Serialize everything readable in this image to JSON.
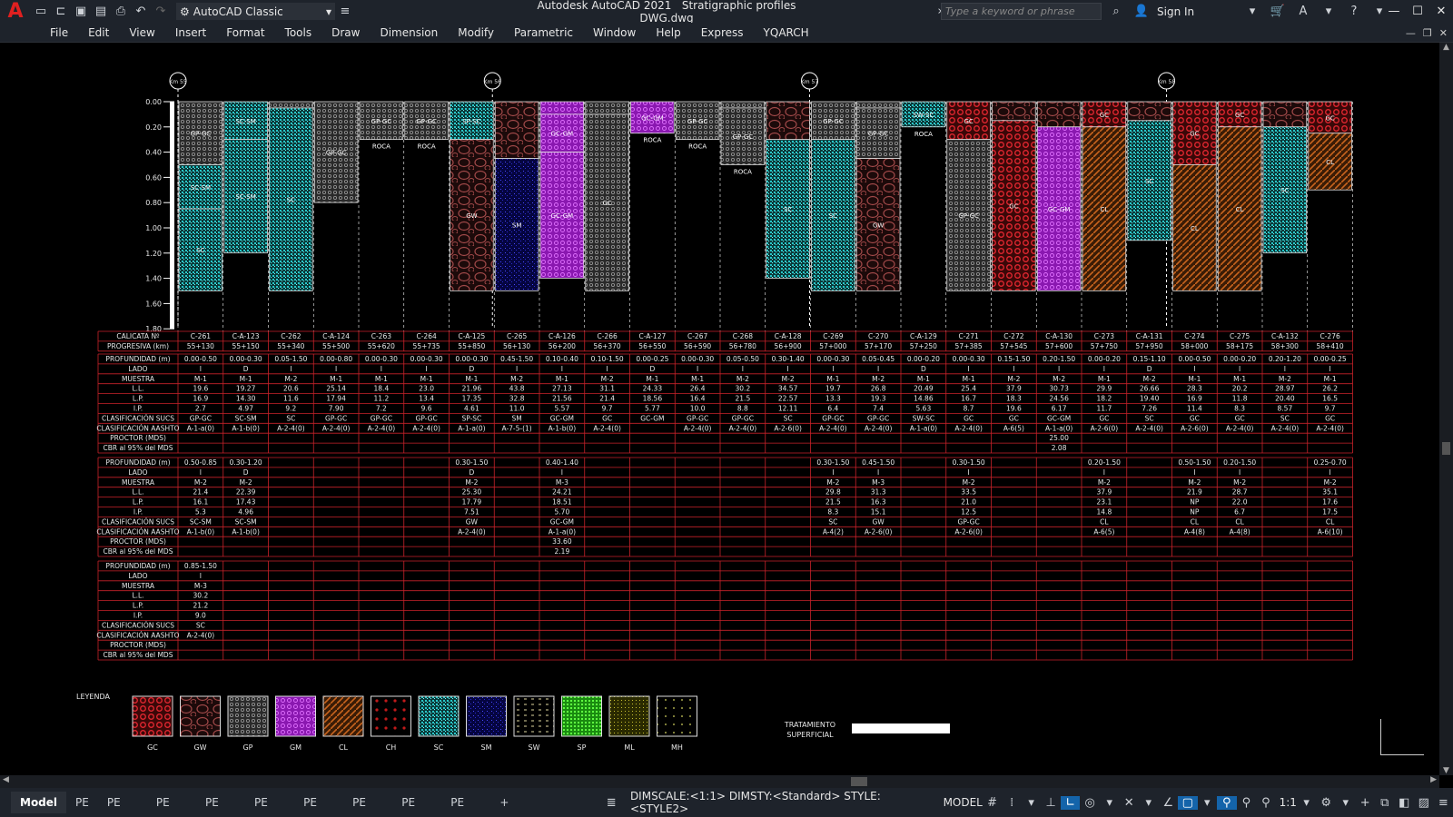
{
  "app": {
    "title": "Autodesk AutoCAD 2021",
    "file": "Stratigraphic profiles DWG.dwg",
    "logo": "A"
  },
  "toolbar": {
    "workspace": "AutoCAD Classic",
    "search_placeholder": "Type a keyword or phrase",
    "sign_in": "Sign In"
  },
  "menu": [
    "File",
    "Edit",
    "View",
    "Insert",
    "Format",
    "Tools",
    "Draw",
    "Dimension",
    "Modify",
    "Parametric",
    "Window",
    "Help",
    "Express",
    "YQARCH"
  ],
  "colors": {
    "GC": "#e0262f",
    "GW": "#8a3a3a",
    "GP": "#9a9a9a",
    "GM": "#b22ad6",
    "CL": "#c9641e",
    "CH": "#c11a1a",
    "SC": "#27c6c8",
    "SM": "#2424c0",
    "SW": "#d8d8d8",
    "SP": "#2ec81c",
    "ML": "#a7a020",
    "MH": "#c8c8c8"
  },
  "drawing": {
    "km_marks": [
      "Km 55",
      "Km 56",
      "Km 57",
      "Km 58"
    ],
    "depth_labels": [
      "0.00",
      "0.20",
      "0.40",
      "0.60",
      "0.80",
      "1.00",
      "1.20",
      "1.40",
      "1.60",
      "1.80"
    ],
    "calicatas": [
      "C-261",
      "C-A-123",
      "C-262",
      "C-A-124",
      "C-263",
      "C-264",
      "C-A-125",
      "C-265",
      "C-A-126",
      "C-266",
      "C-A-127",
      "C-267",
      "C-268",
      "C-A-128",
      "C-269",
      "C-270",
      "C-A-129",
      "C-271",
      "C-272",
      "C-A-130",
      "C-273",
      "C-A-131",
      "C-274",
      "C-275",
      "C-A-132",
      "C-276"
    ],
    "progresivas": [
      "55+130",
      "55+150",
      "55+340",
      "55+500",
      "55+620",
      "55+735",
      "55+850",
      "56+130",
      "56+200",
      "56+370",
      "56+550",
      "56+590",
      "56+780",
      "56+900",
      "57+000",
      "57+170",
      "57+250",
      "57+385",
      "57+545",
      "57+600",
      "57+750",
      "57+950",
      "58+000",
      "58+175",
      "58+300",
      "58+410"
    ],
    "row_labels": [
      "PROFUNDIDAD (m)",
      "LADO",
      "MUESTRA",
      "L.L.",
      "L.P.",
      "I.P.",
      "CLASIFICACIÓN SUCS",
      "CLASIFICACIÓN AASHTO",
      "PROCTOR (MDS)",
      "CBR al 95% del MDS"
    ],
    "header_labels": [
      "CALICATA Nº",
      "PROGRESIVA (km)"
    ],
    "block1": [
      [
        "0.00-0.50",
        "I",
        "M-1",
        "19.6",
        "16.9",
        "2.7",
        "GP-GC",
        "A-1-a(0)",
        "",
        ""
      ],
      [
        "0.00-0.30",
        "D",
        "M-1",
        "19.27",
        "14.30",
        "4.97",
        "SC-SM",
        "A-1-b(0)",
        "",
        ""
      ],
      [
        "0.05-1.50",
        "I",
        "M-2",
        "20.6",
        "11.6",
        "9.2",
        "SC",
        "A-2-4(0)",
        "",
        ""
      ],
      [
        "0.00-0.80",
        "I",
        "M-1",
        "25.14",
        "17.94",
        "7.90",
        "GP-GC",
        "A-2-4(0)",
        "",
        ""
      ],
      [
        "0.00-0.30",
        "I",
        "M-1",
        "18.4",
        "11.2",
        "7.2",
        "GP-GC",
        "A-2-4(0)",
        "",
        ""
      ],
      [
        "0.00-0.30",
        "I",
        "M-1",
        "23.0",
        "13.4",
        "9.6",
        "GP-GC",
        "A-2-4(0)",
        "",
        ""
      ],
      [
        "0.00-0.30",
        "D",
        "M-1",
        "21.96",
        "17.35",
        "4.61",
        "SP-SC",
        "A-1-a(0)",
        "",
        ""
      ],
      [
        "0.45-1.50",
        "I",
        "M-2",
        "43.8",
        "32.8",
        "11.0",
        "SM",
        "A-7-5-(1)",
        "",
        ""
      ],
      [
        "0.10-0.40",
        "I",
        "M-1",
        "27.13",
        "21.56",
        "5.57",
        "GC-GM",
        "A-1-b(0)",
        "",
        ""
      ],
      [
        "0.10-1.50",
        "I",
        "M-2",
        "31.1",
        "21.4",
        "9.7",
        "GC",
        "A-2-4(0)",
        "",
        ""
      ],
      [
        "0.00-0.25",
        "D",
        "M-1",
        "24.33",
        "18.56",
        "5.77",
        "GC-GM",
        "",
        "",
        ""
      ],
      [
        "0.00-0.30",
        "I",
        "M-1",
        "26.4",
        "16.4",
        "10.0",
        "GP-GC",
        "A-2-4(0)",
        "",
        ""
      ],
      [
        "0.05-0.50",
        "I",
        "M-2",
        "30.2",
        "21.5",
        "8.8",
        "GP-GC",
        "A-2-4(0)",
        "",
        ""
      ],
      [
        "0.30-1.40",
        "I",
        "M-2",
        "34.57",
        "22.57",
        "12.11",
        "SC",
        "A-2-6(0)",
        "",
        ""
      ],
      [
        "0.00-0.30",
        "I",
        "M-1",
        "19.7",
        "13.3",
        "6.4",
        "GP-GC",
        "A-2-4(0)",
        "",
        ""
      ],
      [
        "0.05-0.45",
        "I",
        "M-2",
        "26.8",
        "19.3",
        "7.4",
        "GP-GC",
        "A-2-4(0)",
        "",
        ""
      ],
      [
        "0.00-0.20",
        "D",
        "M-1",
        "20.49",
        "14.86",
        "5.63",
        "SW-SC",
        "A-1-a(0)",
        "",
        ""
      ],
      [
        "0.00-0.30",
        "I",
        "M-1",
        "25.4",
        "16.7",
        "8.7",
        "GC",
        "A-2-4(0)",
        "",
        ""
      ],
      [
        "0.15-1.50",
        "I",
        "M-2",
        "37.9",
        "18.3",
        "19.6",
        "GC",
        "A-6(5)",
        "",
        ""
      ],
      [
        "0.20-1.50",
        "I",
        "M-2",
        "30.73",
        "24.56",
        "6.17",
        "GC-GM",
        "A-1-a(0)",
        "25.00",
        "2.08"
      ],
      [
        "0.00-0.20",
        "I",
        "M-1",
        "29.9",
        "18.2",
        "11.7",
        "GC",
        "A-2-6(0)",
        "",
        ""
      ],
      [
        "0.15-1.10",
        "D",
        "M-2",
        "26.66",
        "19.40",
        "7.26",
        "SC",
        "A-2-4(0)",
        "",
        ""
      ],
      [
        "0.00-0.50",
        "I",
        "M-1",
        "28.3",
        "16.9",
        "11.4",
        "GC",
        "A-2-6(0)",
        "",
        ""
      ],
      [
        "0.00-0.20",
        "I",
        "M-1",
        "20.2",
        "11.8",
        "8.3",
        "GC",
        "A-2-4(0)",
        "",
        ""
      ],
      [
        "0.20-1.20",
        "I",
        "M-2",
        "28.97",
        "20.40",
        "8.57",
        "SC",
        "A-2-4(0)",
        "",
        ""
      ],
      [
        "0.00-0.25",
        "I",
        "M-1",
        "26.2",
        "16.5",
        "9.7",
        "GC",
        "A-2-4(0)",
        "",
        ""
      ]
    ],
    "block2": [
      [
        "0.50-0.85",
        "I",
        "M-2",
        "21.4",
        "16.1",
        "5.3",
        "SC-SM",
        "A-1-b(0)",
        "",
        ""
      ],
      [
        "0.30-1.20",
        "D",
        "M-2",
        "22.39",
        "17.43",
        "4.96",
        "SC-SM",
        "A-1-b(0)",
        "",
        ""
      ],
      [
        "",
        "",
        "",
        "",
        "",
        "",
        "",
        "",
        "",
        ""
      ],
      [
        "",
        "",
        "",
        "",
        "",
        "",
        "",
        "",
        "",
        ""
      ],
      [
        "",
        "",
        "",
        "",
        "",
        "",
        "",
        "",
        "",
        ""
      ],
      [
        "",
        "",
        "",
        "",
        "",
        "",
        "",
        "",
        "",
        ""
      ],
      [
        "0.30-1.50",
        "D",
        "M-2",
        "25.30",
        "17.79",
        "7.51",
        "GW",
        "A-2-4(0)",
        "",
        ""
      ],
      [
        "",
        "",
        "",
        "",
        "",
        "",
        "",
        "",
        "",
        ""
      ],
      [
        "0.40-1.40",
        "I",
        "M-3",
        "24.21",
        "18.51",
        "5.70",
        "GC-GM",
        "A-1-a(0)",
        "33.60",
        "2.19"
      ],
      [
        "",
        "",
        "",
        "",
        "",
        "",
        "",
        "",
        "",
        ""
      ],
      [
        "",
        "",
        "",
        "",
        "",
        "",
        "",
        "",
        "",
        ""
      ],
      [
        "",
        "",
        "",
        "",
        "",
        "",
        "",
        "",
        "",
        ""
      ],
      [
        "",
        "",
        "",
        "",
        "",
        "",
        "",
        "",
        "",
        ""
      ],
      [
        "",
        "",
        "",
        "",
        "",
        "",
        "",
        "",
        "",
        ""
      ],
      [
        "0.30-1.50",
        "I",
        "M-2",
        "29.8",
        "21.5",
        "8.3",
        "SC",
        "A-4(2)",
        "",
        ""
      ],
      [
        "0.45-1.50",
        "I",
        "M-3",
        "31.3",
        "16.3",
        "15.1",
        "GW",
        "A-2-6(0)",
        "",
        ""
      ],
      [
        "",
        "",
        "",
        "",
        "",
        "",
        "",
        "",
        "",
        ""
      ],
      [
        "0.30-1.50",
        "I",
        "M-2",
        "33.5",
        "21.0",
        "12.5",
        "GP-GC",
        "A-2-6(0)",
        "",
        ""
      ],
      [
        "",
        "",
        "",
        "",
        "",
        "",
        "",
        "",
        "",
        ""
      ],
      [
        "",
        "",
        "",
        "",
        "",
        "",
        "",
        "",
        "",
        ""
      ],
      [
        "0.20-1.50",
        "I",
        "M-2",
        "37.9",
        "23.1",
        "14.8",
        "CL",
        "A-6(5)",
        "",
        ""
      ],
      [
        "",
        "",
        "",
        "",
        "",
        "",
        "",
        "",
        "",
        ""
      ],
      [
        "0.50-1.50",
        "I",
        "M-2",
        "21.9",
        "NP",
        "NP",
        "CL",
        "A-4(8)",
        "",
        ""
      ],
      [
        "0.20-1.50",
        "I",
        "M-2",
        "28.7",
        "22.0",
        "6.7",
        "CL",
        "A-4(8)",
        "",
        ""
      ],
      [
        "",
        "",
        "",
        "",
        "",
        "",
        "",
        "",
        "",
        ""
      ],
      [
        "0.25-0.70",
        "I",
        "M-2",
        "35.1",
        "17.6",
        "17.5",
        "CL",
        "A-6(10)",
        "",
        ""
      ]
    ],
    "block3_first": [
      "0.85-1.50",
      "I",
      "M-3",
      "30.2",
      "21.2",
      "9.0",
      "SC",
      "A-2-4(0)",
      "",
      ""
    ],
    "profiles": [
      [
        [
          0,
          0.5,
          "GP",
          "GP-GC"
        ],
        [
          0.5,
          0.85,
          "SC",
          "SC-SM"
        ],
        [
          0.85,
          1.5,
          "SC",
          "SC"
        ]
      ],
      [
        [
          0,
          0.3,
          "SC",
          "SC-SM"
        ],
        [
          0.3,
          1.2,
          "SC",
          "SC-SM"
        ]
      ],
      [
        [
          0,
          0.05,
          "GP",
          ""
        ],
        [
          0.05,
          1.5,
          "SC",
          "SC"
        ]
      ],
      [
        [
          0,
          0.8,
          "GP",
          "GP-GC"
        ]
      ],
      [
        [
          0,
          0.3,
          "GP",
          "GP-GC"
        ]
      ],
      [
        [
          0,
          0.3,
          "GP",
          "GP-GC"
        ]
      ],
      [
        [
          0,
          0.3,
          "SC",
          "SP-SC"
        ],
        [
          0.3,
          1.5,
          "GW",
          "GW"
        ]
      ],
      [
        [
          0,
          0.45,
          "GW",
          ""
        ],
        [
          0.45,
          1.5,
          "SM",
          "SM"
        ]
      ],
      [
        [
          0,
          0.1,
          "GM",
          ""
        ],
        [
          0.1,
          0.4,
          "GM",
          "GC-GM"
        ],
        [
          0.4,
          1.4,
          "GM",
          "GC-GM"
        ]
      ],
      [
        [
          0,
          0.1,
          "GP",
          ""
        ],
        [
          0.1,
          1.5,
          "GP",
          "GC"
        ]
      ],
      [
        [
          0,
          0.25,
          "GM",
          "GC-GM"
        ]
      ],
      [
        [
          0,
          0.3,
          "GP",
          "GP-GC"
        ]
      ],
      [
        [
          0,
          0.05,
          "GP",
          ""
        ],
        [
          0.05,
          0.5,
          "GP",
          "GP-GC"
        ]
      ],
      [
        [
          0,
          0.3,
          "GW",
          ""
        ],
        [
          0.3,
          1.4,
          "SC",
          "SC"
        ]
      ],
      [
        [
          0,
          0.3,
          "GP",
          "GP-GC"
        ],
        [
          0.3,
          1.5,
          "SC",
          "SC"
        ]
      ],
      [
        [
          0,
          0.05,
          "GP",
          ""
        ],
        [
          0.05,
          0.45,
          "GP",
          "GP-GC"
        ],
        [
          0.45,
          1.5,
          "GW",
          "GW"
        ]
      ],
      [
        [
          0,
          0.2,
          "SC",
          "SW-SC"
        ]
      ],
      [
        [
          0,
          0.3,
          "GC",
          "GC"
        ],
        [
          0.3,
          1.5,
          "GP",
          "GP-GC"
        ]
      ],
      [
        [
          0,
          0.15,
          "GW",
          ""
        ],
        [
          0.15,
          1.5,
          "GC",
          "GC"
        ]
      ],
      [
        [
          0,
          0.2,
          "GW",
          ""
        ],
        [
          0.2,
          1.5,
          "GM",
          "GC-GM"
        ]
      ],
      [
        [
          0,
          0.2,
          "GC",
          "GC"
        ],
        [
          0.2,
          1.5,
          "CL",
          "CL"
        ]
      ],
      [
        [
          0,
          0.15,
          "GW",
          ""
        ],
        [
          0.15,
          1.1,
          "SC",
          "SC"
        ]
      ],
      [
        [
          0,
          0.5,
          "GC",
          "GC"
        ],
        [
          0.5,
          1.5,
          "CL",
          "CL"
        ]
      ],
      [
        [
          0,
          0.2,
          "GC",
          "GC"
        ],
        [
          0.2,
          1.5,
          "CL",
          "CL"
        ]
      ],
      [
        [
          0,
          0.2,
          "GW",
          ""
        ],
        [
          0.2,
          1.2,
          "SC",
          "SC"
        ]
      ],
      [
        [
          0,
          0.25,
          "GC",
          "GC"
        ],
        [
          0.25,
          0.7,
          "CL",
          "CL"
        ]
      ]
    ],
    "roca": [
      "",
      "",
      "",
      "",
      "ROCA",
      "ROCA",
      "",
      "",
      "",
      "",
      "ROCA",
      "ROCA",
      "ROCA",
      "",
      "",
      "",
      "ROCA",
      "",
      "",
      "",
      "",
      "",
      "",
      "",
      "",
      ""
    ],
    "legend_title": "LEYENDA",
    "legend": [
      "GC",
      "GW",
      "GP",
      "GM",
      "CL",
      "CH",
      "SC",
      "SM",
      "SW",
      "SP",
      "ML",
      "MH"
    ],
    "tratamiento": [
      "TRATAMIENTO",
      "SUPERFICIAL"
    ]
  },
  "layout_tabs": [
    "Model",
    "PE",
    "PE (2)",
    "PE (3)",
    "PE (4)",
    "PE (5)",
    "PE (6)",
    "PE (7)",
    "PE (8)",
    "PE (9)",
    "+"
  ],
  "status": {
    "text": "DIMSCALE:<1:1> DIMSTY:<Standard> STYLE:<STYLE2>",
    "model": "MODEL",
    "scale": "1:1"
  }
}
